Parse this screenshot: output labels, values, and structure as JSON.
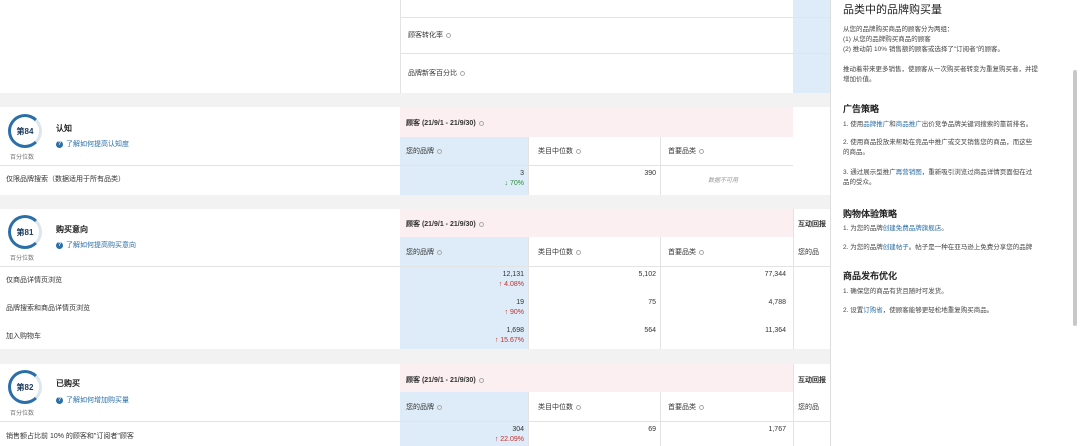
{
  "top_block": {
    "rows": [
      "顾客转化率",
      "品牌新客百分比"
    ]
  },
  "labels": {
    "percentile": "百分位数",
    "your_brand": "您的品牌",
    "category_median": "类目中位数",
    "top_category": "首要品类",
    "interactive_col": "互动回报",
    "interactive_short": "互动回",
    "your_brand_short": "您的品"
  },
  "sections": [
    {
      "rank": "第84",
      "title": "认知",
      "help": "了解如何提高认知度",
      "period": "顾客 (21/9/1 - 21/9/30)",
      "rows": [
        {
          "label": "仅限品牌搜索（数据适用于所有品类）",
          "brand": "3",
          "delta": "↓ 70%",
          "median": "390",
          "top": "数据不可用"
        }
      ]
    },
    {
      "rank": "第81",
      "title": "购买意向",
      "help": "了解如何提高购买意向",
      "period": "顾客 (21/9/1 - 21/9/30)",
      "rows": [
        {
          "label": "仅商品详情页浏览",
          "brand": "12,131",
          "delta": "↑ 4.08%",
          "median": "5,102",
          "top": "77,344"
        },
        {
          "label": "品牌搜索和商品详情页浏览",
          "brand": "19",
          "delta": "↑ 90%",
          "median": "75",
          "top": "4,788"
        },
        {
          "label": "加入购物车",
          "brand": "1,698",
          "delta": "↑ 15.67%",
          "median": "564",
          "top": "11,364"
        }
      ]
    },
    {
      "rank": "第82",
      "title": "已购买",
      "help": "了解如何增加购买量",
      "period": "顾客 (21/9/1 - 21/9/30)",
      "rows": [
        {
          "label": "销售额占比前 10% 的顾客和\"订阅者\"顾客",
          "brand": "304",
          "delta": "↑ 22.09%",
          "median": "69",
          "top": "1,767"
        }
      ]
    }
  ],
  "side": {
    "title": "品类中的品牌购买量",
    "intro": [
      "从您的品牌购买商品的顾客分为两组：",
      "(1) 从您的品牌购买商品的顾客",
      "(2) 推动前 10% 销售额的顾客或选择了\"订阅者\"的顾客。"
    ],
    "intro2": [
      "推动着带来更多销售，使顾客从一次购买者转变为重复购买者，并提",
      "增加价值。"
    ],
    "ad_title": "广告策略",
    "ad_items": [
      {
        "pre": "1. 使用",
        "l1": "品牌推广",
        "mid": "和",
        "l2": "商品推广",
        "post": "出价竞争品牌关键词搜索的靠前排名。"
      },
      {
        "line1": "2. 使用商品投放来帮助在竞品中推广或交叉销售您的商品，而这些",
        "line2": "的商品。"
      },
      {
        "pre": "3. 通过展示型推广",
        "l1": "再营销图",
        "post": "，重新吸引浏览过商品详情页面但在过",
        "line2": "品的受众。"
      }
    ],
    "exp_title": "购物体验策略",
    "exp_items": [
      {
        "pre": "1. 为您的品牌",
        "l1": "创建免费品牌旗舰店",
        "post": "。"
      },
      {
        "pre": "2. 为您的品牌",
        "l1": "创建帖子",
        "post": "。帖子是一种在亚马逊上免费分享您的品牌"
      }
    ],
    "pub_title": "商品发布优化",
    "pub_items": [
      "1. 确保您的商品有货且随时可发货。",
      {
        "pre": "2. 设置",
        "l1": "订购省",
        "post": "，使顾客能够更轻松地重复购买商品。"
      }
    ]
  },
  "colors": {
    "accent": "#2b6fa8",
    "up": "#c0312c",
    "down": "#2e8b3e",
    "header_pink": "#fbeff2",
    "brand_col_blue": "#ddecf8"
  }
}
